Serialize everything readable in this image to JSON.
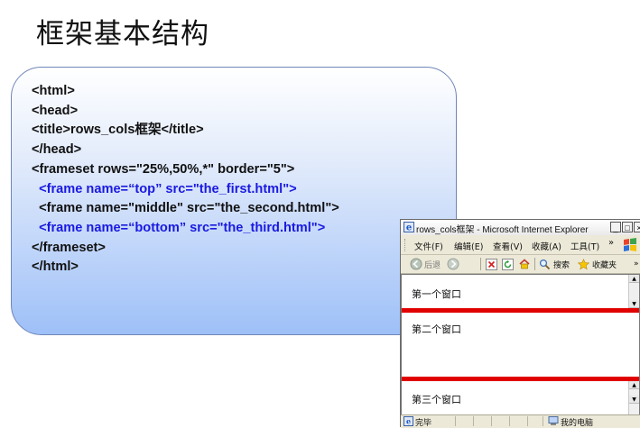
{
  "slide": {
    "title": "框架基本结构"
  },
  "code": {
    "lines": [
      {
        "text": "<html>",
        "color": "#111111"
      },
      {
        "text": "<head>",
        "color": "#111111"
      },
      {
        "text": "<title>rows_cols框架</title>",
        "color": "#111111"
      },
      {
        "text": "</head>",
        "color": "#111111"
      },
      {
        "text": "<frameset rows=\"25%,50%,*\" border=\"5\">",
        "color": "#111111"
      },
      {
        "text": "  <frame name=“top” src=\"the_first.html\">",
        "color": "#1a1ae0"
      },
      {
        "text": "  <frame name=\"middle\" src=\"the_second.html\">",
        "color": "#111111"
      },
      {
        "text": "  <frame name=“bottom” src=\"the_third.html\">",
        "color": "#1a1ae0"
      },
      {
        "text": "</frameset>",
        "color": "#111111"
      },
      {
        "text": "</html>",
        "color": "#111111"
      }
    ]
  },
  "browser": {
    "title": "rows_cols框架 - Microsoft Internet Explorer",
    "window_buttons": {
      "minimize": "_",
      "maximize": "□",
      "close": "×"
    },
    "menu": [
      "文件(F)",
      "编辑(E)",
      "查看(V)",
      "收藏(A)",
      "工具(T)"
    ],
    "menu_overflow": "»",
    "toolbar": {
      "back": "后退",
      "search": "搜索",
      "favorites": "收藏夹",
      "overflow": "»"
    },
    "frames": [
      {
        "name": "top",
        "text": "第一个窗口"
      },
      {
        "name": "middle",
        "text": "第二个窗口"
      },
      {
        "name": "bottom",
        "text": "第三个窗口"
      }
    ],
    "frame_border_color": "#e00000",
    "statusbar": {
      "left": "完毕",
      "zone": "我的电脑"
    }
  }
}
